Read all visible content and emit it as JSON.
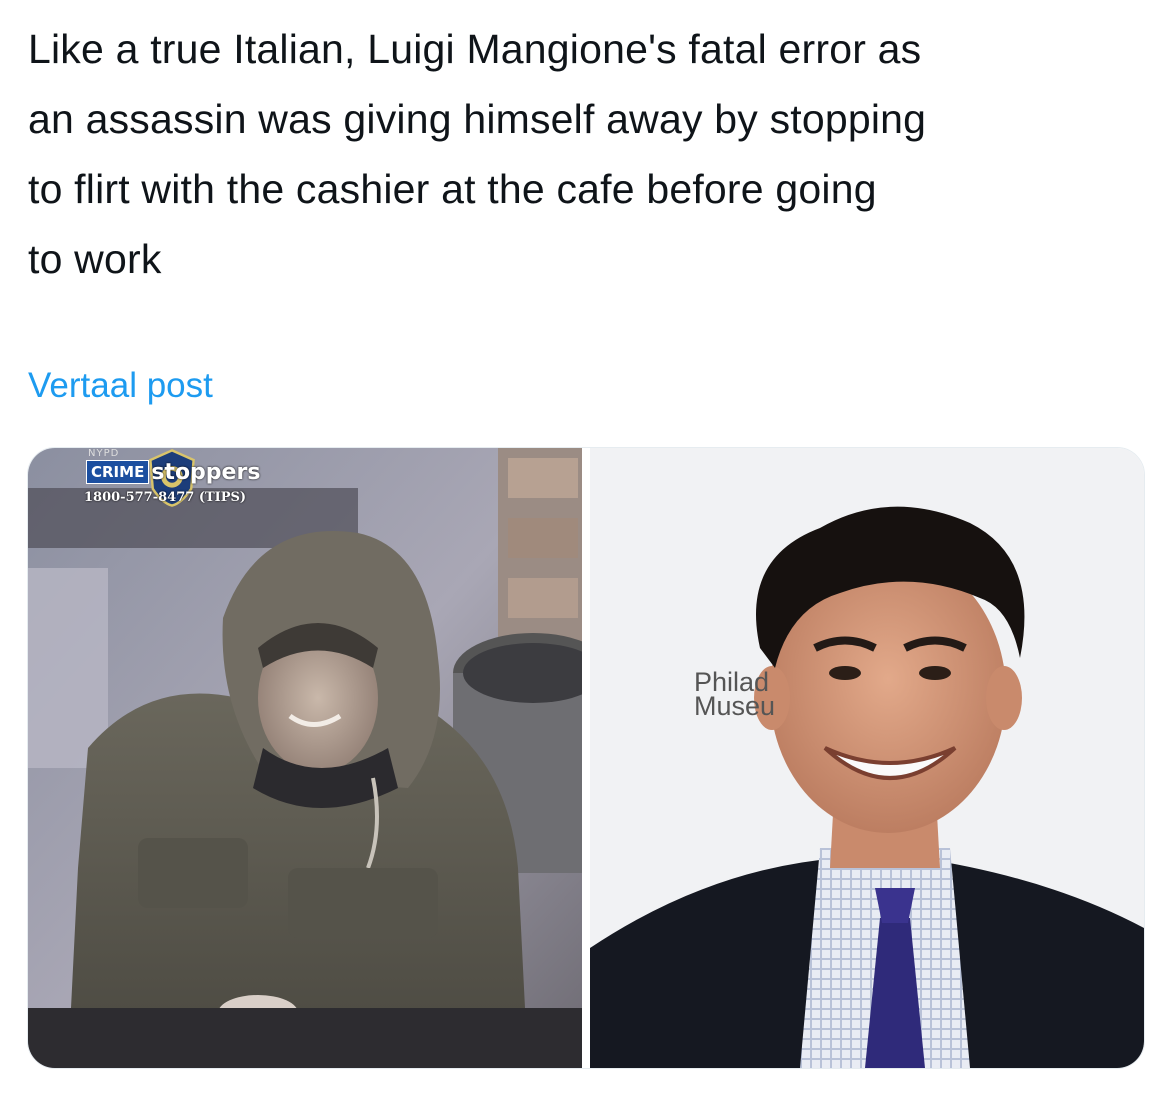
{
  "post": {
    "text_lines": [
      "Like a true Italian, Luigi Mangione's fatal error as",
      "an assassin was giving himself away by stopping",
      "to flirt with the cashier at the cafe before going",
      "to work"
    ],
    "translate_label": "Vertaal post"
  },
  "media": {
    "left_photo": {
      "overlay_small": "NYPD",
      "overlay_crime": "CRIME",
      "overlay_stoppers": "stoppers",
      "overlay_phone": "1800-577-8477 (TIPS)"
    },
    "right_photo": {
      "backdrop_line1": "Philad",
      "backdrop_line2": "Museu"
    }
  },
  "colors": {
    "text": "#0f1419",
    "link": "#1d9bf0",
    "crime_badge": "#1c4fa0"
  }
}
